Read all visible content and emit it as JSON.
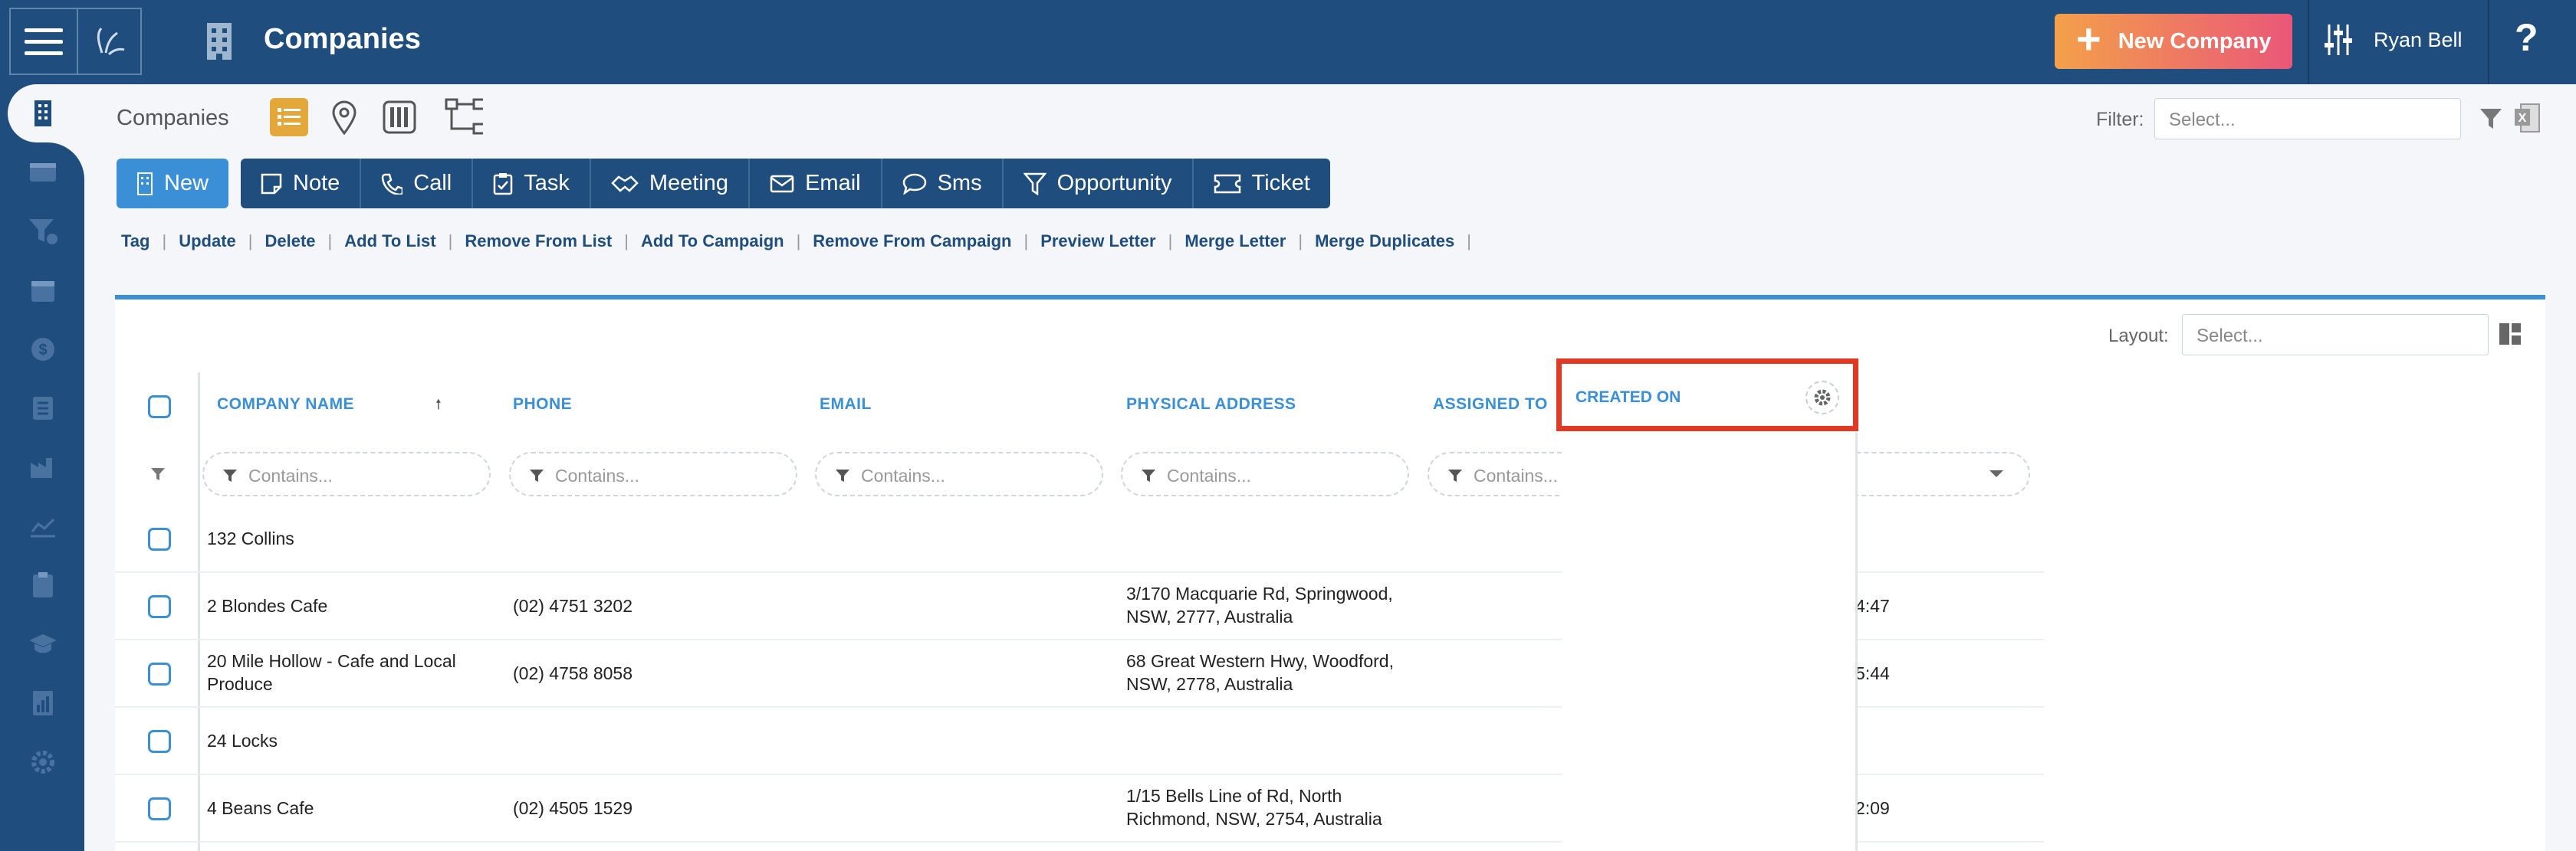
{
  "header": {
    "title": "Companies",
    "new_company_label": "New Company",
    "user_name": "Ryan Bell",
    "help": "?"
  },
  "breadcrumb": {
    "label": "Companies"
  },
  "filter": {
    "label": "Filter:",
    "placeholder": "Select..."
  },
  "actions": [
    {
      "label": "New"
    },
    {
      "label": "Note"
    },
    {
      "label": "Call"
    },
    {
      "label": "Task"
    },
    {
      "label": "Meeting"
    },
    {
      "label": "Email"
    },
    {
      "label": "Sms"
    },
    {
      "label": "Opportunity"
    },
    {
      "label": "Ticket"
    }
  ],
  "links": [
    "Tag",
    "Update",
    "Delete",
    "Add To List",
    "Remove From List",
    "Add To Campaign",
    "Remove From Campaign",
    "Preview Letter",
    "Merge Letter",
    "Merge Duplicates"
  ],
  "layout": {
    "label": "Layout:",
    "placeholder": "Select..."
  },
  "table": {
    "columns": [
      "COMPANY NAME",
      "PHONE",
      "EMAIL",
      "PHYSICAL ADDRESS",
      "ASSIGNED TO",
      "CREATED ON"
    ],
    "filter_placeholder": "Contains...",
    "rows": [
      {
        "name": "132 Collins",
        "phone": "",
        "address_1": "",
        "address_2": "",
        "created": ""
      },
      {
        "name": "2 Blondes Cafe",
        "phone": "(02) 4751 3202",
        "address_1": "3/170 Macquarie Rd, Springwood,",
        "address_2": "NSW, 2777, Australia",
        "created": "4:47"
      },
      {
        "name": "20 Mile Hollow - Cafe and Local",
        "name_2": "Produce",
        "phone": "(02) 4758 8058",
        "address_1": "68 Great Western Hwy, Woodford,",
        "address_2": "NSW, 2778, Australia",
        "created": "5:44"
      },
      {
        "name": "24 Locks",
        "phone": "",
        "address_1": "",
        "address_2": "",
        "created": ""
      },
      {
        "name": "4 Beans Cafe",
        "phone": "(02) 4505 1529",
        "address_1": "1/15 Bells Line of Rd, North",
        "address_2": "Richmond, NSW, 2754, Australia",
        "created": "2:09"
      }
    ]
  },
  "colors": {
    "navy": "#1f4e7e",
    "accent": "#3a8fd6",
    "highlight": "#e03a25",
    "gold": "#e3a73a"
  }
}
